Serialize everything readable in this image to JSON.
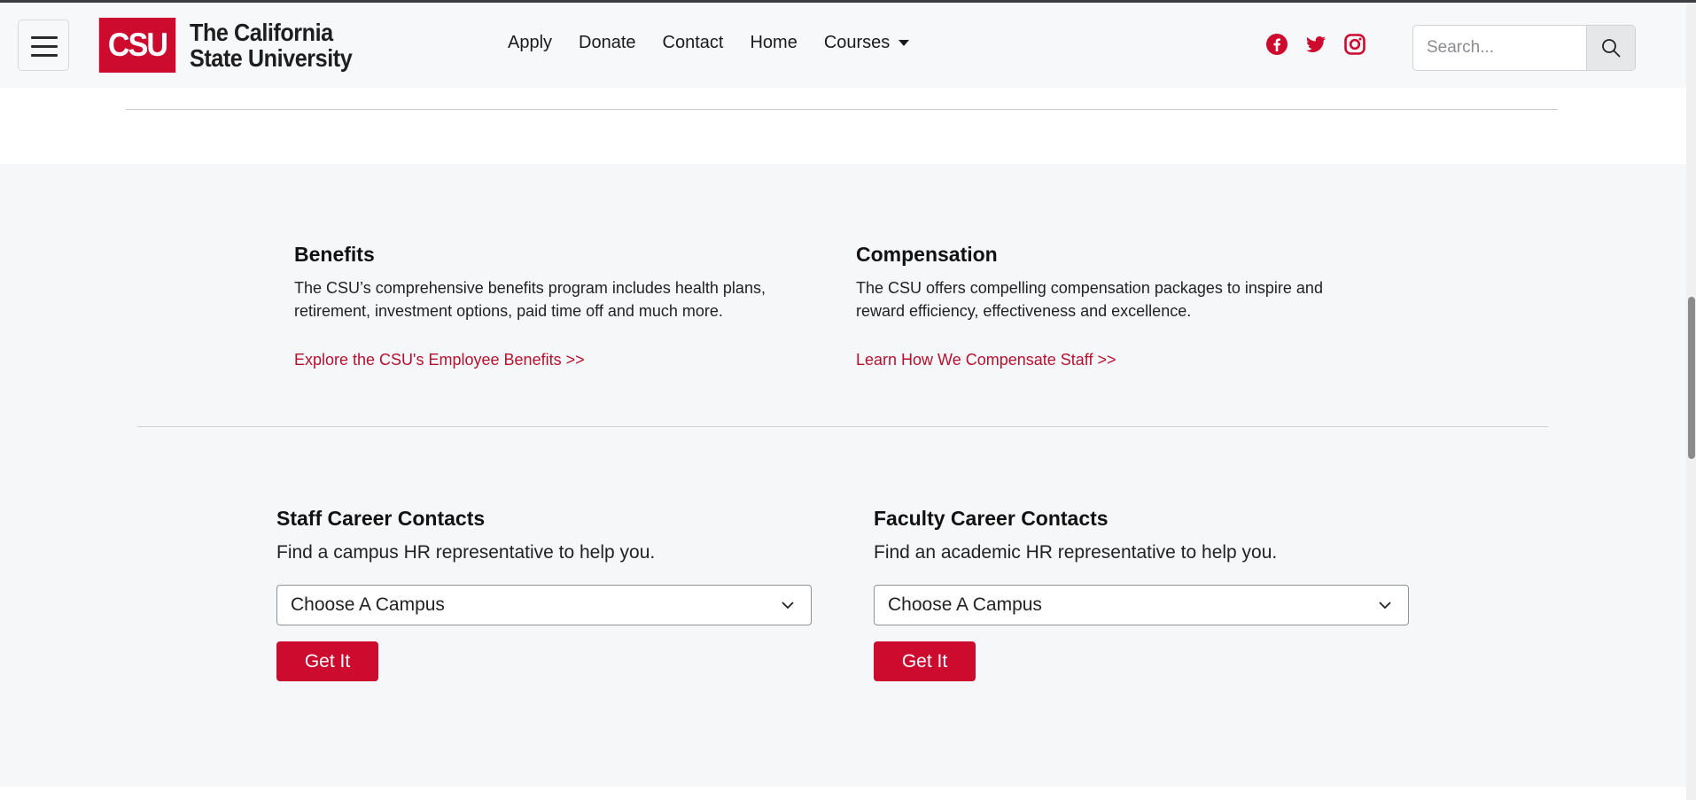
{
  "header": {
    "logo": {
      "mark": "CSU",
      "line1": "The California",
      "line2": "State University"
    },
    "nav": [
      {
        "label": "Apply"
      },
      {
        "label": "Donate"
      },
      {
        "label": "Contact"
      },
      {
        "label": "Home"
      },
      {
        "label": "Courses"
      }
    ],
    "social": [
      "facebook-icon",
      "twitter-icon",
      "instagram-icon"
    ],
    "search": {
      "placeholder": "Search...",
      "value": ""
    }
  },
  "cards": {
    "benefits": {
      "title": "Benefits",
      "text_line1": "The CSU’s comprehensive benefits program includes health plans,",
      "text_line2": "retirement, investment options, paid time off and much more.",
      "link": "Explore the CSU's Employee Benefits >>"
    },
    "compensation": {
      "title": "Compensation",
      "text_line1": "The CSU offers compelling compensation packages to inspire and",
      "text_line2": "reward efficiency, effectiveness and excellence.",
      "link": "Learn How We Compensate Staff >>"
    }
  },
  "contacts": {
    "staff": {
      "title": "Staff Career Contacts",
      "subtitle": "Find a campus HR representative to help you.",
      "select_value": "Choose A Campus",
      "button": "Get It"
    },
    "faculty": {
      "title": "Faculty Career Contacts",
      "subtitle": "Find an academic HR representative to help you.",
      "select_value": "Choose A Campus",
      "button": "Get It"
    }
  },
  "colors": {
    "brand_red": "#cc0b2f",
    "link_red": "#b5112f",
    "section_grey": "#f6f7f9"
  }
}
